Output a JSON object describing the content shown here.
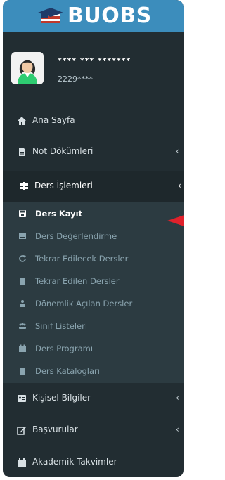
{
  "brand": {
    "name": "BUOBS"
  },
  "user": {
    "name": "**** *** *******",
    "id": "2229****"
  },
  "menu": {
    "home": "Ana Sayfa",
    "grades": "Not Dökümleri",
    "courses": "Ders İşlemleri",
    "personal": "Kişisel Bilgiler",
    "applications": "Başvurular",
    "calendar": "Akademik Takvimler"
  },
  "submenu": [
    {
      "label": "Ders Kayıt",
      "icon": "save-icon",
      "active": true
    },
    {
      "label": "Ders Değerlendirme",
      "icon": "list-icon"
    },
    {
      "label": "Tekrar Edilecek Dersler",
      "icon": "refresh-icon"
    },
    {
      "label": "Tekrar Edilen Dersler",
      "icon": "book-icon"
    },
    {
      "label": "Dönemlik Açılan Dersler",
      "icon": "users-icon"
    },
    {
      "label": "Sınıf Listeleri",
      "icon": "group-icon"
    },
    {
      "label": "Ders Programı",
      "icon": "calendar-icon"
    },
    {
      "label": "Ders Katalogları",
      "icon": "book-icon"
    }
  ],
  "colors": {
    "sidebar": "#222d32",
    "logo_bar": "#3c8dbc",
    "submenu": "#2c3b41",
    "pointer_arrow": "#e0212b"
  }
}
